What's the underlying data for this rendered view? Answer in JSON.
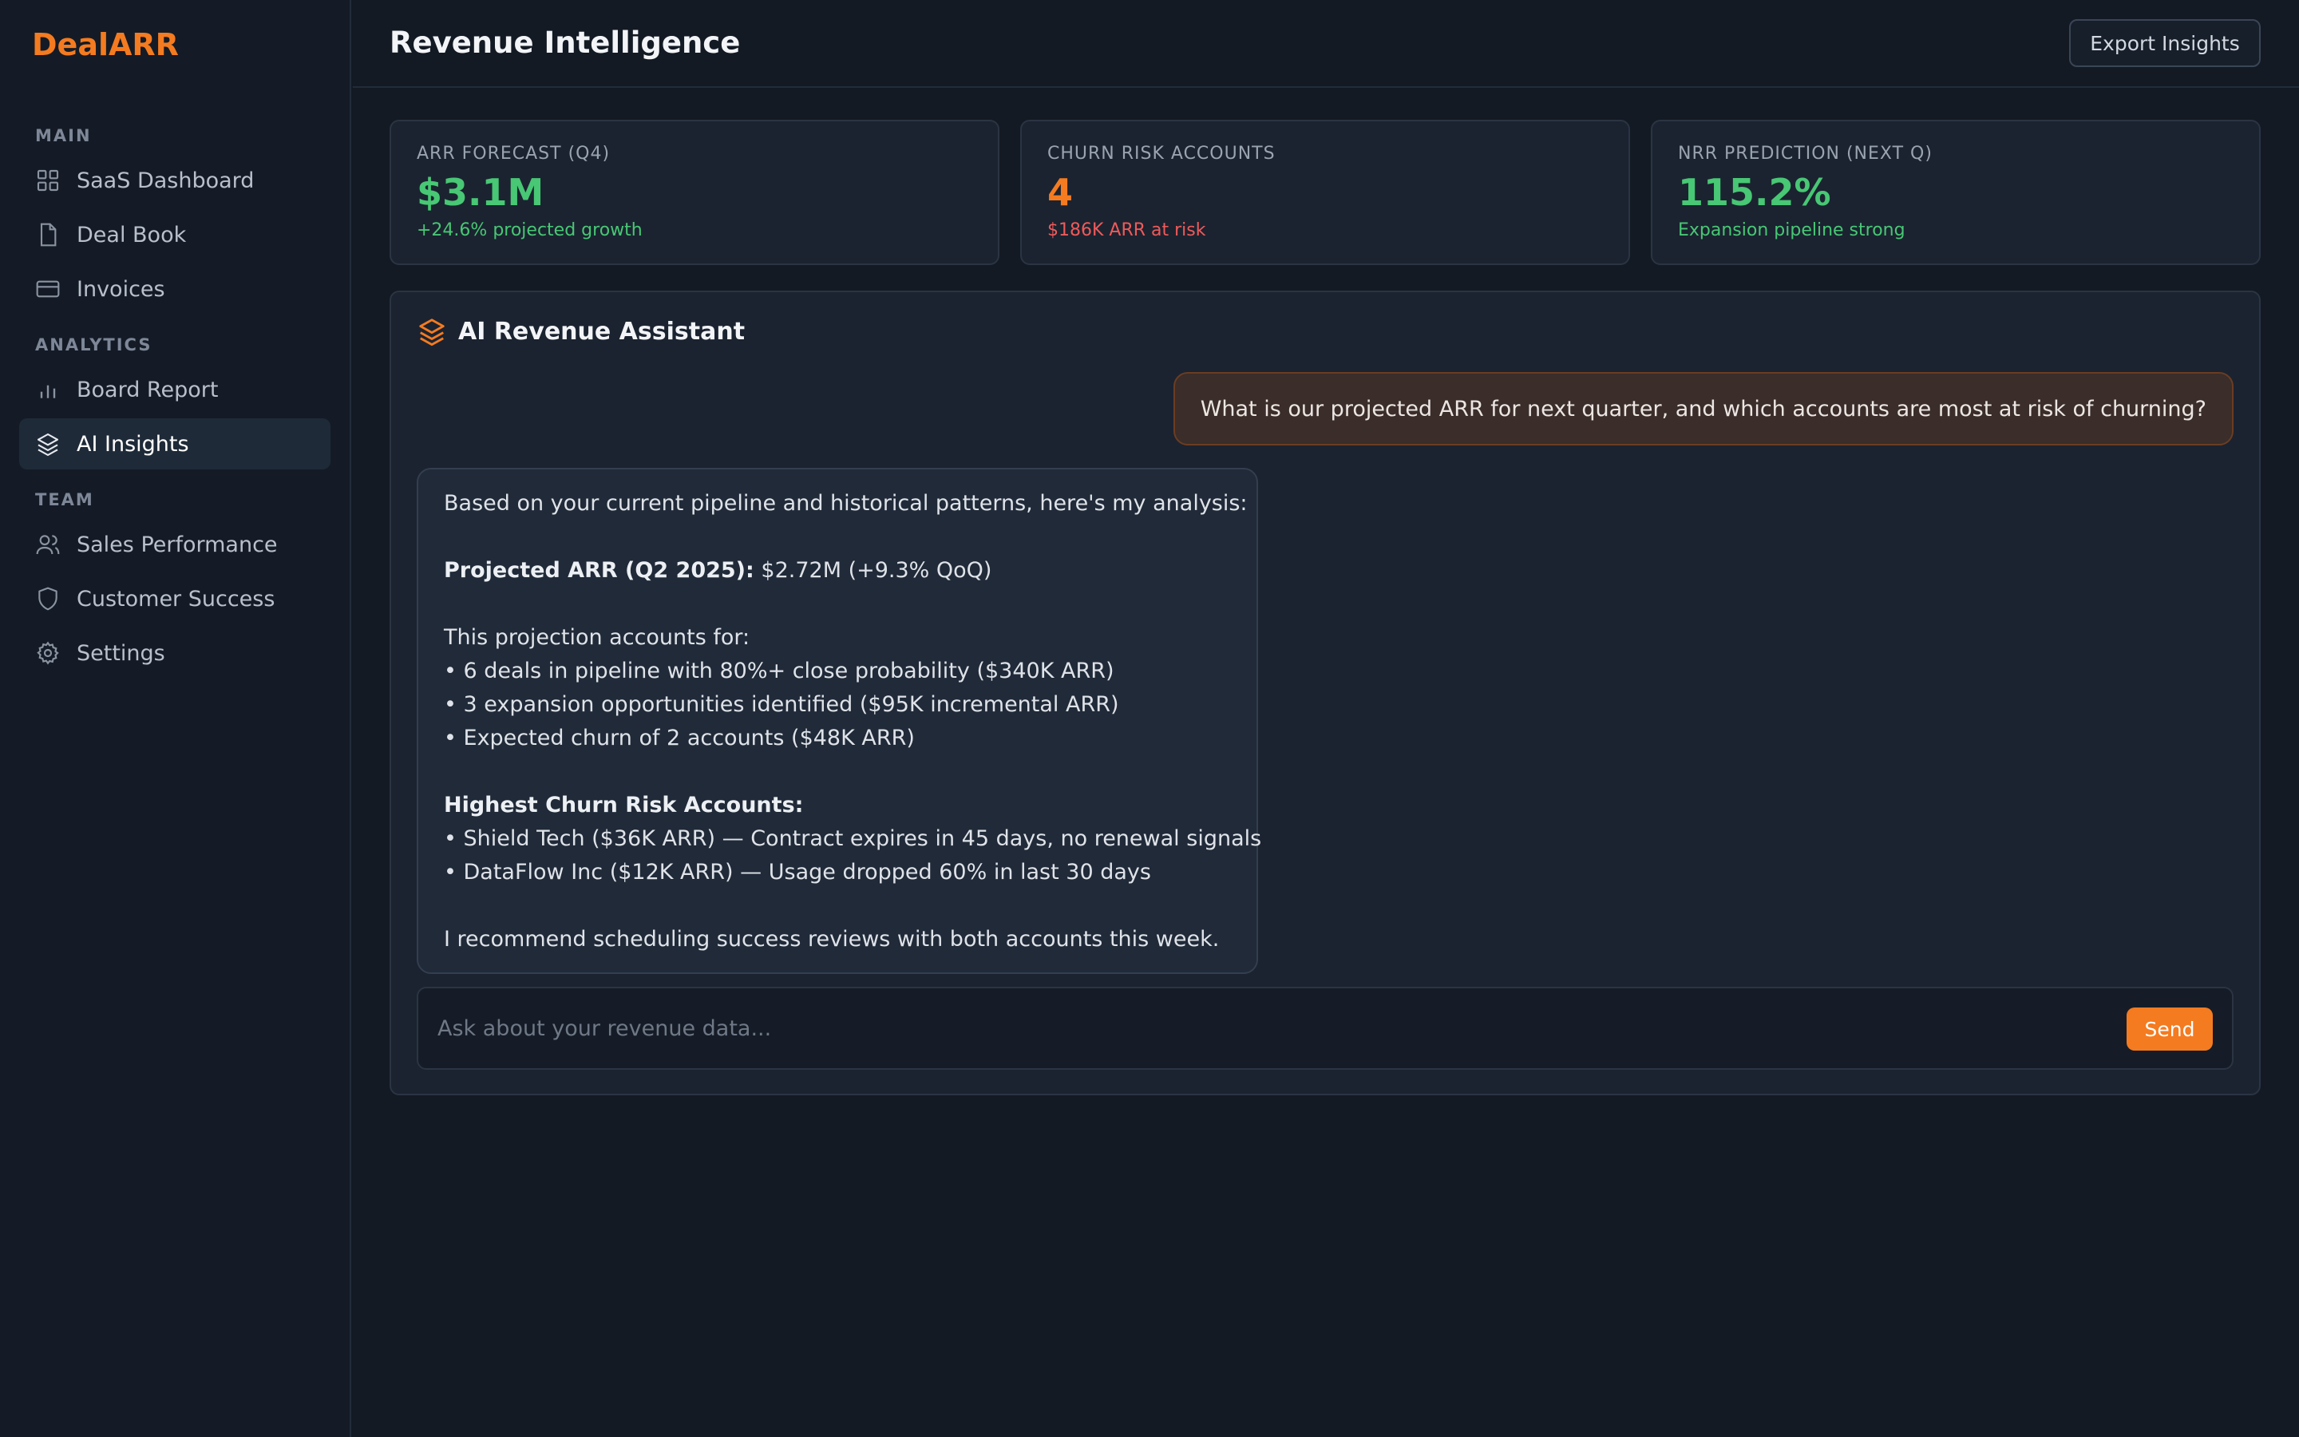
{
  "app": {
    "logo": "DealARR"
  },
  "sidebar": {
    "sections": [
      {
        "label": "MAIN"
      },
      {
        "label": "ANALYTICS"
      },
      {
        "label": "TEAM"
      }
    ],
    "items": [
      {
        "label": "SaaS Dashboard",
        "icon": "grid-icon"
      },
      {
        "label": "Deal Book",
        "icon": "file-icon"
      },
      {
        "label": "Invoices",
        "icon": "credit-card-icon"
      },
      {
        "label": "Board Report",
        "icon": "bar-chart-icon"
      },
      {
        "label": "AI Insights",
        "icon": "layers-icon",
        "active": true
      },
      {
        "label": "Sales Performance",
        "icon": "users-icon"
      },
      {
        "label": "Customer Success",
        "icon": "shield-icon"
      },
      {
        "label": "Settings",
        "icon": "gear-icon"
      }
    ]
  },
  "header": {
    "title": "Revenue Intelligence",
    "export_label": "Export Insights"
  },
  "stats": [
    {
      "label": "ARR FORECAST (Q4)",
      "value": "$3.1M",
      "note": "+24.6% projected growth",
      "value_color": "#48c774",
      "note_color": "#48c774"
    },
    {
      "label": "CHURN RISK ACCOUNTS",
      "value": "4",
      "note": "$186K ARR at risk",
      "value_color": "#f47b20",
      "note_color": "#ef5a5a"
    },
    {
      "label": "NRR PREDICTION (NEXT Q)",
      "value": "115.2%",
      "note": "Expansion pipeline strong",
      "value_color": "#48c774",
      "note_color": "#48c774"
    }
  ],
  "assistant": {
    "title": "AI Revenue Assistant",
    "icon": "layers-icon",
    "user_message": "What is our projected ARR for next quarter, and which accounts are most at risk of churning?",
    "response": {
      "intro": "Based on your current pipeline and historical patterns, here's my analysis:",
      "projection_label": "Projected ARR (Q2 2025):",
      "projection_value": " $2.72M (+9.3% QoQ)",
      "accounts_for": "This projection accounts for:",
      "bullets": [
        "• 6 deals in pipeline with 80%+ close probability ($340K ARR)",
        "• 3 expansion opportunities identified ($95K incremental ARR)",
        "• Expected churn of 2 accounts ($48K ARR)"
      ],
      "risk_heading": "Highest Churn Risk Accounts:",
      "risk_bullets": [
        "• Shield Tech ($36K ARR) — Contract expires in 45 days, no renewal signals",
        "• DataFlow Inc ($12K ARR) — Usage dropped 60% in last 30 days"
      ],
      "recommendation": "I recommend scheduling success reviews with both accounts this week."
    },
    "input_placeholder": "Ask about your revenue data...",
    "input_value": "",
    "send_label": "Send"
  },
  "colors": {
    "accent": "#f47b20",
    "positive": "#48c774",
    "negative": "#ef5a5a"
  }
}
